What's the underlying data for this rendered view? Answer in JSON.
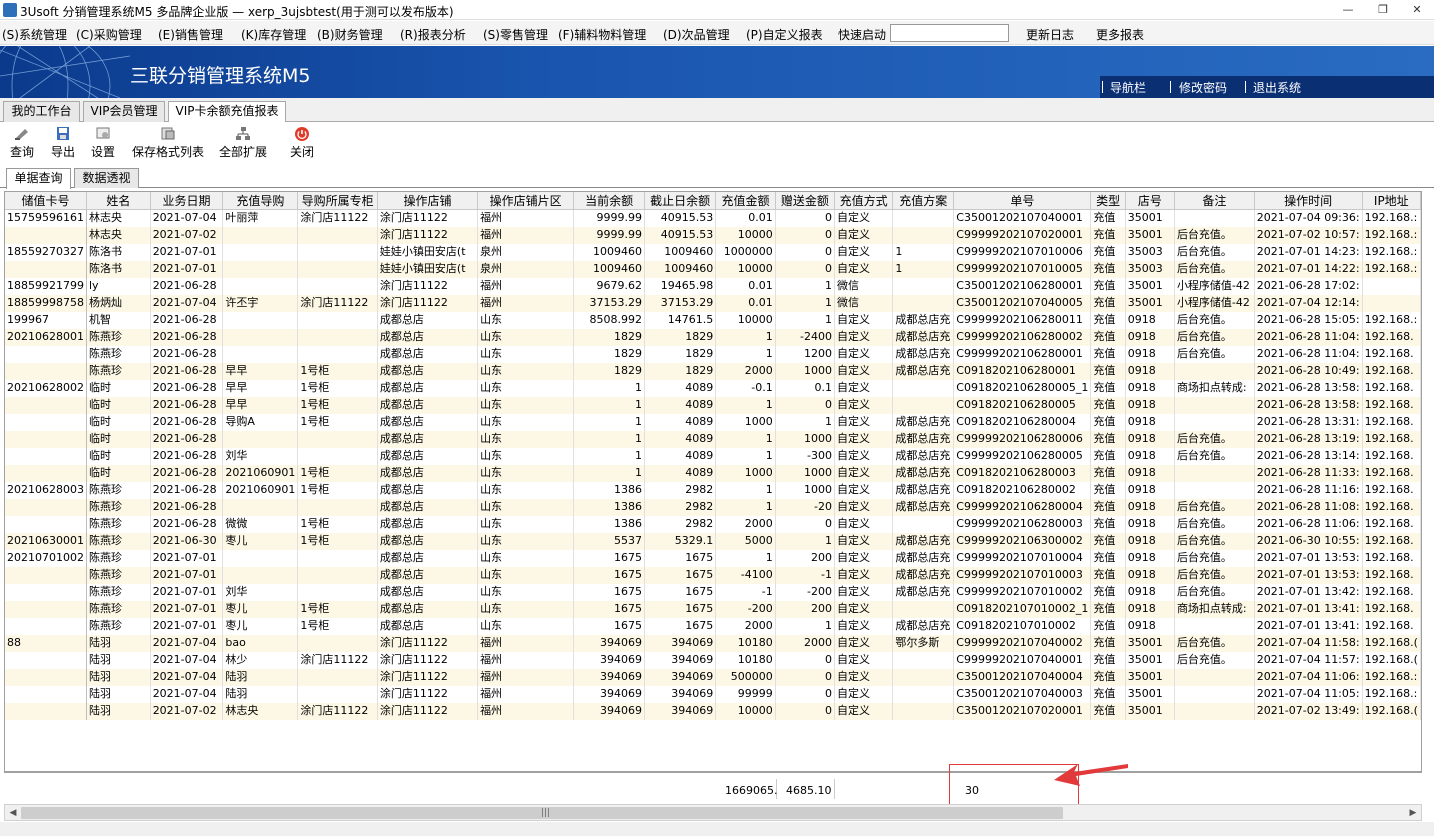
{
  "window": {
    "title": "3Usoft 分销管理系统M5 多品牌企业版 — xerp_3ujsbtest(用于测可以发布版本)",
    "minimize": "—",
    "restore": "❐",
    "close": "✕"
  },
  "menu": {
    "items": [
      "(S)系统管理",
      "(C)采购管理",
      "(E)销售管理",
      "(K)库存管理",
      "(B)财务管理",
      "(R)报表分析",
      "(S)零售管理",
      "(F)辅料物料管理",
      "(D)次品管理",
      "(P)自定义报表"
    ],
    "quick_start_label": "快速启动",
    "quick_start_value": "",
    "update_log": "更新日志",
    "more_reports": "更多报表"
  },
  "banner": {
    "title": "三联分销管理系统M5",
    "nav": "导航栏",
    "change_password": "修改密码",
    "logout": "退出系统"
  },
  "tabs": [
    {
      "label": "我的工作台"
    },
    {
      "label": "VIP会员管理"
    },
    {
      "label": "VIP卡余额充值报表"
    }
  ],
  "toolbar": {
    "query": "查询",
    "export": "导出",
    "settings": "设置",
    "save_format": "保存格式列表",
    "expand_all": "全部扩展",
    "close": "关闭"
  },
  "subtabs": {
    "detail": "单据查询",
    "pivot": "数据透视"
  },
  "grid": {
    "columns": [
      "储值卡号",
      "姓名",
      "业务日期",
      "充值导购",
      "导购所属专柜",
      "操作店铺",
      "操作店铺片区",
      "当前余额",
      "截止日余额",
      "充值金额",
      "赠送金额",
      "充值方式",
      "充值方案",
      "单号",
      "类型",
      "店号",
      "备注",
      "操作时间",
      "IP地址"
    ],
    "rows": [
      [
        "15759596161",
        "林志央",
        "2021-07-04",
        "叶丽萍",
        "涂门店11122",
        "涂门店11122",
        "福州",
        "9999.99",
        "40915.53",
        "0.01",
        "0",
        "自定义",
        "",
        "C35001202107040001",
        "充值",
        "35001",
        "",
        "2021-07-04 09:36:",
        "192.168.:"
      ],
      [
        "",
        "林志央",
        "2021-07-02",
        "",
        "",
        "涂门店11122",
        "福州",
        "9999.99",
        "40915.53",
        "10000",
        "0",
        "自定义",
        "",
        "C99999202107020001",
        "充值",
        "35001",
        "后台充值。",
        "2021-07-02 10:57:",
        "192.168.:"
      ],
      [
        "18559270327",
        "陈洛书",
        "2021-07-01",
        "",
        "",
        "娃娃小镇田安店(t",
        "泉州",
        "1009460",
        "1009460",
        "1000000",
        "0",
        "自定义",
        "1",
        "C99999202107010006",
        "充值",
        "35003",
        "后台充值。",
        "2021-07-01 14:23:",
        "192.168.:"
      ],
      [
        "",
        "陈洛书",
        "2021-07-01",
        "",
        "",
        "娃娃小镇田安店(t",
        "泉州",
        "1009460",
        "1009460",
        "10000",
        "0",
        "自定义",
        "1",
        "C99999202107010005",
        "充值",
        "35003",
        "后台充值。",
        "2021-07-01 14:22:",
        "192.168.:"
      ],
      [
        "18859921799",
        "ly",
        "2021-06-28",
        "",
        "",
        "涂门店11122",
        "福州",
        "9679.62",
        "19465.98",
        "0.01",
        "1",
        "微信",
        "",
        "C35001202106280001",
        "充值",
        "35001",
        "小程序储值-42",
        "2021-06-28 17:02:",
        ""
      ],
      [
        "18859998758",
        "杨炳灿",
        "2021-07-04",
        "许丕宇",
        "涂门店11122",
        "涂门店11122",
        "福州",
        "37153.29",
        "37153.29",
        "0.01",
        "1",
        "微信",
        "",
        "C35001202107040005",
        "充值",
        "35001",
        "小程序储值-42",
        "2021-07-04 12:14:",
        ""
      ],
      [
        "199967",
        "机智",
        "2021-06-28",
        "",
        "",
        "成都总店",
        "山东",
        "8508.992",
        "14761.5",
        "10000",
        "1",
        "自定义",
        "成都总店充",
        "C99999202106280011",
        "充值",
        "0918",
        "后台充值。",
        "2021-06-28 15:05:",
        "192.168.:"
      ],
      [
        "20210628001",
        "陈燕珍",
        "2021-06-28",
        "",
        "",
        "成都总店",
        "山东",
        "1829",
        "1829",
        "1",
        "-2400",
        "自定义",
        "成都总店充",
        "C99999202106280002",
        "充值",
        "0918",
        "后台充值。",
        "2021-06-28 11:04:",
        "192.168."
      ],
      [
        "",
        "陈燕珍",
        "2021-06-28",
        "",
        "",
        "成都总店",
        "山东",
        "1829",
        "1829",
        "1",
        "1200",
        "自定义",
        "成都总店充",
        "C99999202106280001",
        "充值",
        "0918",
        "后台充值。",
        "2021-06-28 11:04:",
        "192.168."
      ],
      [
        "",
        "陈燕珍",
        "2021-06-28",
        "早早",
        "1号柜",
        "成都总店",
        "山东",
        "1829",
        "1829",
        "2000",
        "1000",
        "自定义",
        "成都总店充",
        "C0918202106280001",
        "充值",
        "0918",
        "",
        "2021-06-28 10:49:",
        "192.168."
      ],
      [
        "20210628002",
        "临时",
        "2021-06-28",
        "早早",
        "1号柜",
        "成都总店",
        "山东",
        "1",
        "4089",
        "-0.1",
        "0.1",
        "自定义",
        "",
        "C0918202106280005_1",
        "充值",
        "0918",
        "商场扣点转成:",
        "2021-06-28 13:58:",
        "192.168."
      ],
      [
        "",
        "临时",
        "2021-06-28",
        "早早",
        "1号柜",
        "成都总店",
        "山东",
        "1",
        "4089",
        "1",
        "0",
        "自定义",
        "",
        "C0918202106280005",
        "充值",
        "0918",
        "",
        "2021-06-28 13:58:",
        "192.168."
      ],
      [
        "",
        "临时",
        "2021-06-28",
        "导购A",
        "1号柜",
        "成都总店",
        "山东",
        "1",
        "4089",
        "1000",
        "1",
        "自定义",
        "成都总店充",
        "C0918202106280004",
        "充值",
        "0918",
        "",
        "2021-06-28 13:31:",
        "192.168."
      ],
      [
        "",
        "临时",
        "2021-06-28",
        "",
        "",
        "成都总店",
        "山东",
        "1",
        "4089",
        "1",
        "1000",
        "自定义",
        "成都总店充",
        "C99999202106280006",
        "充值",
        "0918",
        "后台充值。",
        "2021-06-28 13:19:",
        "192.168."
      ],
      [
        "",
        "临时",
        "2021-06-28",
        "刘华",
        "",
        "成都总店",
        "山东",
        "1",
        "4089",
        "1",
        "-300",
        "自定义",
        "成都总店充",
        "C99999202106280005",
        "充值",
        "0918",
        "后台充值。",
        "2021-06-28 13:14:",
        "192.168."
      ],
      [
        "",
        "临时",
        "2021-06-28",
        "2021060901",
        "1号柜",
        "成都总店",
        "山东",
        "1",
        "4089",
        "1000",
        "1000",
        "自定义",
        "成都总店充",
        "C0918202106280003",
        "充值",
        "0918",
        "",
        "2021-06-28 11:33:",
        "192.168."
      ],
      [
        "20210628003",
        "陈燕珍",
        "2021-06-28",
        "2021060901",
        "1号柜",
        "成都总店",
        "山东",
        "1386",
        "2982",
        "1",
        "1000",
        "自定义",
        "成都总店充",
        "C0918202106280002",
        "充值",
        "0918",
        "",
        "2021-06-28 11:16:",
        "192.168."
      ],
      [
        "",
        "陈燕珍",
        "2021-06-28",
        "",
        "",
        "成都总店",
        "山东",
        "1386",
        "2982",
        "1",
        "-20",
        "自定义",
        "成都总店充",
        "C99999202106280004",
        "充值",
        "0918",
        "后台充值。",
        "2021-06-28 11:08:",
        "192.168."
      ],
      [
        "",
        "陈燕珍",
        "2021-06-28",
        "微微",
        "1号柜",
        "成都总店",
        "山东",
        "1386",
        "2982",
        "2000",
        "0",
        "自定义",
        "",
        "C99999202106280003",
        "充值",
        "0918",
        "后台充值。",
        "2021-06-28 11:06:",
        "192.168."
      ],
      [
        "20210630001",
        "陈燕珍",
        "2021-06-30",
        "枣儿",
        "1号柜",
        "成都总店",
        "山东",
        "5537",
        "5329.1",
        "5000",
        "1",
        "自定义",
        "成都总店充",
        "C99999202106300002",
        "充值",
        "0918",
        "后台充值。",
        "2021-06-30 10:55:",
        "192.168."
      ],
      [
        "20210701002",
        "陈燕珍",
        "2021-07-01",
        "",
        "",
        "成都总店",
        "山东",
        "1675",
        "1675",
        "1",
        "200",
        "自定义",
        "成都总店充",
        "C99999202107010004",
        "充值",
        "0918",
        "后台充值。",
        "2021-07-01 13:53:",
        "192.168."
      ],
      [
        "",
        "陈燕珍",
        "2021-07-01",
        "",
        "",
        "成都总店",
        "山东",
        "1675",
        "1675",
        "-4100",
        "-1",
        "自定义",
        "成都总店充",
        "C99999202107010003",
        "充值",
        "0918",
        "后台充值。",
        "2021-07-01 13:53:",
        "192.168."
      ],
      [
        "",
        "陈燕珍",
        "2021-07-01",
        "刘华",
        "",
        "成都总店",
        "山东",
        "1675",
        "1675",
        "-1",
        "-200",
        "自定义",
        "成都总店充",
        "C99999202107010002",
        "充值",
        "0918",
        "后台充值。",
        "2021-07-01 13:42:",
        "192.168."
      ],
      [
        "",
        "陈燕珍",
        "2021-07-01",
        "枣儿",
        "1号柜",
        "成都总店",
        "山东",
        "1675",
        "1675",
        "-200",
        "200",
        "自定义",
        "",
        "C0918202107010002_1",
        "充值",
        "0918",
        "商场扣点转成:",
        "2021-07-01 13:41:",
        "192.168."
      ],
      [
        "",
        "陈燕珍",
        "2021-07-01",
        "枣儿",
        "1号柜",
        "成都总店",
        "山东",
        "1675",
        "1675",
        "2000",
        "1",
        "自定义",
        "成都总店充",
        "C0918202107010002",
        "充值",
        "0918",
        "",
        "2021-07-01 13:41:",
        "192.168."
      ],
      [
        "88",
        "陆羽",
        "2021-07-04",
        "bao",
        "",
        "涂门店11122",
        "福州",
        "394069",
        "394069",
        "10180",
        "2000",
        "自定义",
        "鄂尔多斯",
        "C99999202107040002",
        "充值",
        "35001",
        "后台充值。",
        "2021-07-04 11:58:",
        "192.168.("
      ],
      [
        "",
        "陆羽",
        "2021-07-04",
        "林少",
        "涂门店11122",
        "涂门店11122",
        "福州",
        "394069",
        "394069",
        "10180",
        "0",
        "自定义",
        "",
        "C99999202107040001",
        "充值",
        "35001",
        "后台充值。",
        "2021-07-04 11:57:",
        "192.168.("
      ],
      [
        "",
        "陆羽",
        "2021-07-04",
        "陆羽",
        "",
        "涂门店11122",
        "福州",
        "394069",
        "394069",
        "500000",
        "0",
        "自定义",
        "",
        "C35001202107040004",
        "充值",
        "35001",
        "",
        "2021-07-04 11:06:",
        "192.168.:"
      ],
      [
        "",
        "陆羽",
        "2021-07-04",
        "陆羽",
        "",
        "涂门店11122",
        "福州",
        "394069",
        "394069",
        "99999",
        "0",
        "自定义",
        "",
        "C35001202107040003",
        "充值",
        "35001",
        "",
        "2021-07-04 11:05:",
        "192.168.:"
      ],
      [
        "",
        "陆羽",
        "2021-07-02",
        "林志央",
        "涂门店11122",
        "涂门店11122",
        "福州",
        "394069",
        "394069",
        "10000",
        "0",
        "自定义",
        "",
        "C35001202107020001",
        "充值",
        "35001",
        "",
        "2021-07-02 13:49:",
        "192.168.("
      ]
    ]
  },
  "footer": {
    "sum_balance": "1669065.",
    "sum_cutoff": "4685.10",
    "record_count": "30"
  },
  "colors": {
    "annotation_red": "#e23a3a"
  }
}
